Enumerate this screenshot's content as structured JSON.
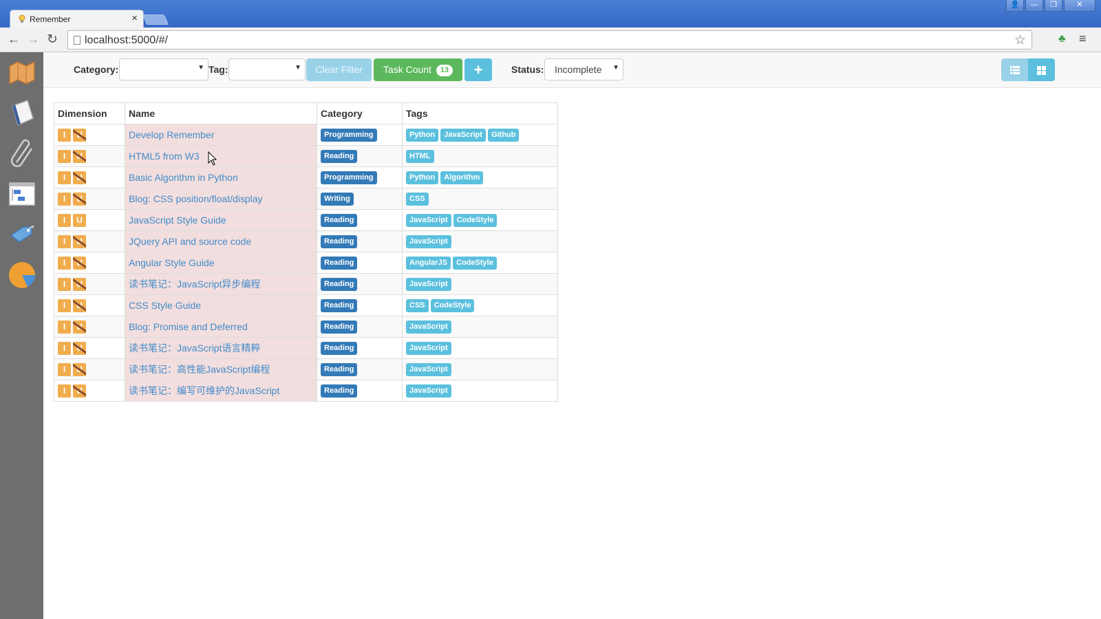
{
  "browser": {
    "tab_title": "Remember",
    "tab_close": "×",
    "url": "localhost:5000/#/",
    "window_buttons": [
      "👤",
      "—",
      "❐",
      "✕"
    ]
  },
  "filters": {
    "category_label": "Category:",
    "category_value": "",
    "tag_label": "Tag:",
    "tag_value": "",
    "clear_filter": "Clear Filter",
    "task_count_label": "Task Count",
    "task_count": "13",
    "add_button": "+",
    "status_label": "Status:",
    "status_value": "Incomplete"
  },
  "table": {
    "headers": [
      "Dimension",
      "Name",
      "Category",
      "Tags"
    ],
    "rows": [
      {
        "dim": [
          "I",
          "U"
        ],
        "u_struck": true,
        "name": "Develop Remember",
        "category": "Programming",
        "tags": [
          "Python",
          "JavaScript",
          "Github"
        ]
      },
      {
        "dim": [
          "I",
          "U"
        ],
        "u_struck": true,
        "name": "HTML5 from W3",
        "category": "Reading",
        "tags": [
          "HTML"
        ]
      },
      {
        "dim": [
          "I",
          "U"
        ],
        "u_struck": true,
        "name": "Basic Algorithm in Python",
        "category": "Programming",
        "tags": [
          "Python",
          "Algorithm"
        ]
      },
      {
        "dim": [
          "I",
          "U"
        ],
        "u_struck": true,
        "name": "Blog: CSS position/float/display",
        "category": "Writing",
        "tags": [
          "CSS"
        ]
      },
      {
        "dim": [
          "I",
          "U"
        ],
        "u_struck": false,
        "name": "JavaScript Style Guide",
        "category": "Reading",
        "tags": [
          "JavaScript",
          "CodeStyle"
        ]
      },
      {
        "dim": [
          "I",
          "U"
        ],
        "u_struck": true,
        "name": "JQuery API and source code",
        "category": "Reading",
        "tags": [
          "JavaScript"
        ]
      },
      {
        "dim": [
          "I",
          "U"
        ],
        "u_struck": true,
        "name": "Angular Style Guide",
        "category": "Reading",
        "tags": [
          "AngularJS",
          "CodeStyle"
        ]
      },
      {
        "dim": [
          "I",
          "U"
        ],
        "u_struck": true,
        "name": "读书笔记：JavaScript异步编程",
        "category": "Reading",
        "tags": [
          "JavaScript"
        ]
      },
      {
        "dim": [
          "I",
          "U"
        ],
        "u_struck": true,
        "name": "CSS Style Guide",
        "category": "Reading",
        "tags": [
          "CSS",
          "CodeStyle"
        ]
      },
      {
        "dim": [
          "I",
          "U"
        ],
        "u_struck": true,
        "name": "Blog: Promise and Deferred",
        "category": "Reading",
        "tags": [
          "JavaScript"
        ]
      },
      {
        "dim": [
          "I",
          "U"
        ],
        "u_struck": true,
        "name": "读书笔记：JavaScript语言精粹",
        "category": "Reading",
        "tags": [
          "JavaScript"
        ]
      },
      {
        "dim": [
          "I",
          "U"
        ],
        "u_struck": true,
        "name": "读书笔记：高性能JavaScript编程",
        "category": "Reading",
        "tags": [
          "JavaScript"
        ]
      },
      {
        "dim": [
          "I",
          "U"
        ],
        "u_struck": true,
        "name": "读书笔记：编写可维护的JavaScript",
        "category": "Reading",
        "tags": [
          "JavaScript"
        ]
      }
    ]
  },
  "sidebar": {
    "items": [
      {
        "icon": "map-icon"
      },
      {
        "icon": "notebook-icon"
      },
      {
        "icon": "paperclip-icon"
      },
      {
        "icon": "task-board-icon"
      },
      {
        "icon": "tag-icon"
      },
      {
        "icon": "pie-chart-icon"
      }
    ]
  },
  "colors": {
    "primary": "#337ab7",
    "info": "#5bc0de",
    "success": "#5cb85c",
    "warning": "#f0ad4e",
    "danger_bg": "#f2dede",
    "sidebar": "#6e6e6e"
  }
}
